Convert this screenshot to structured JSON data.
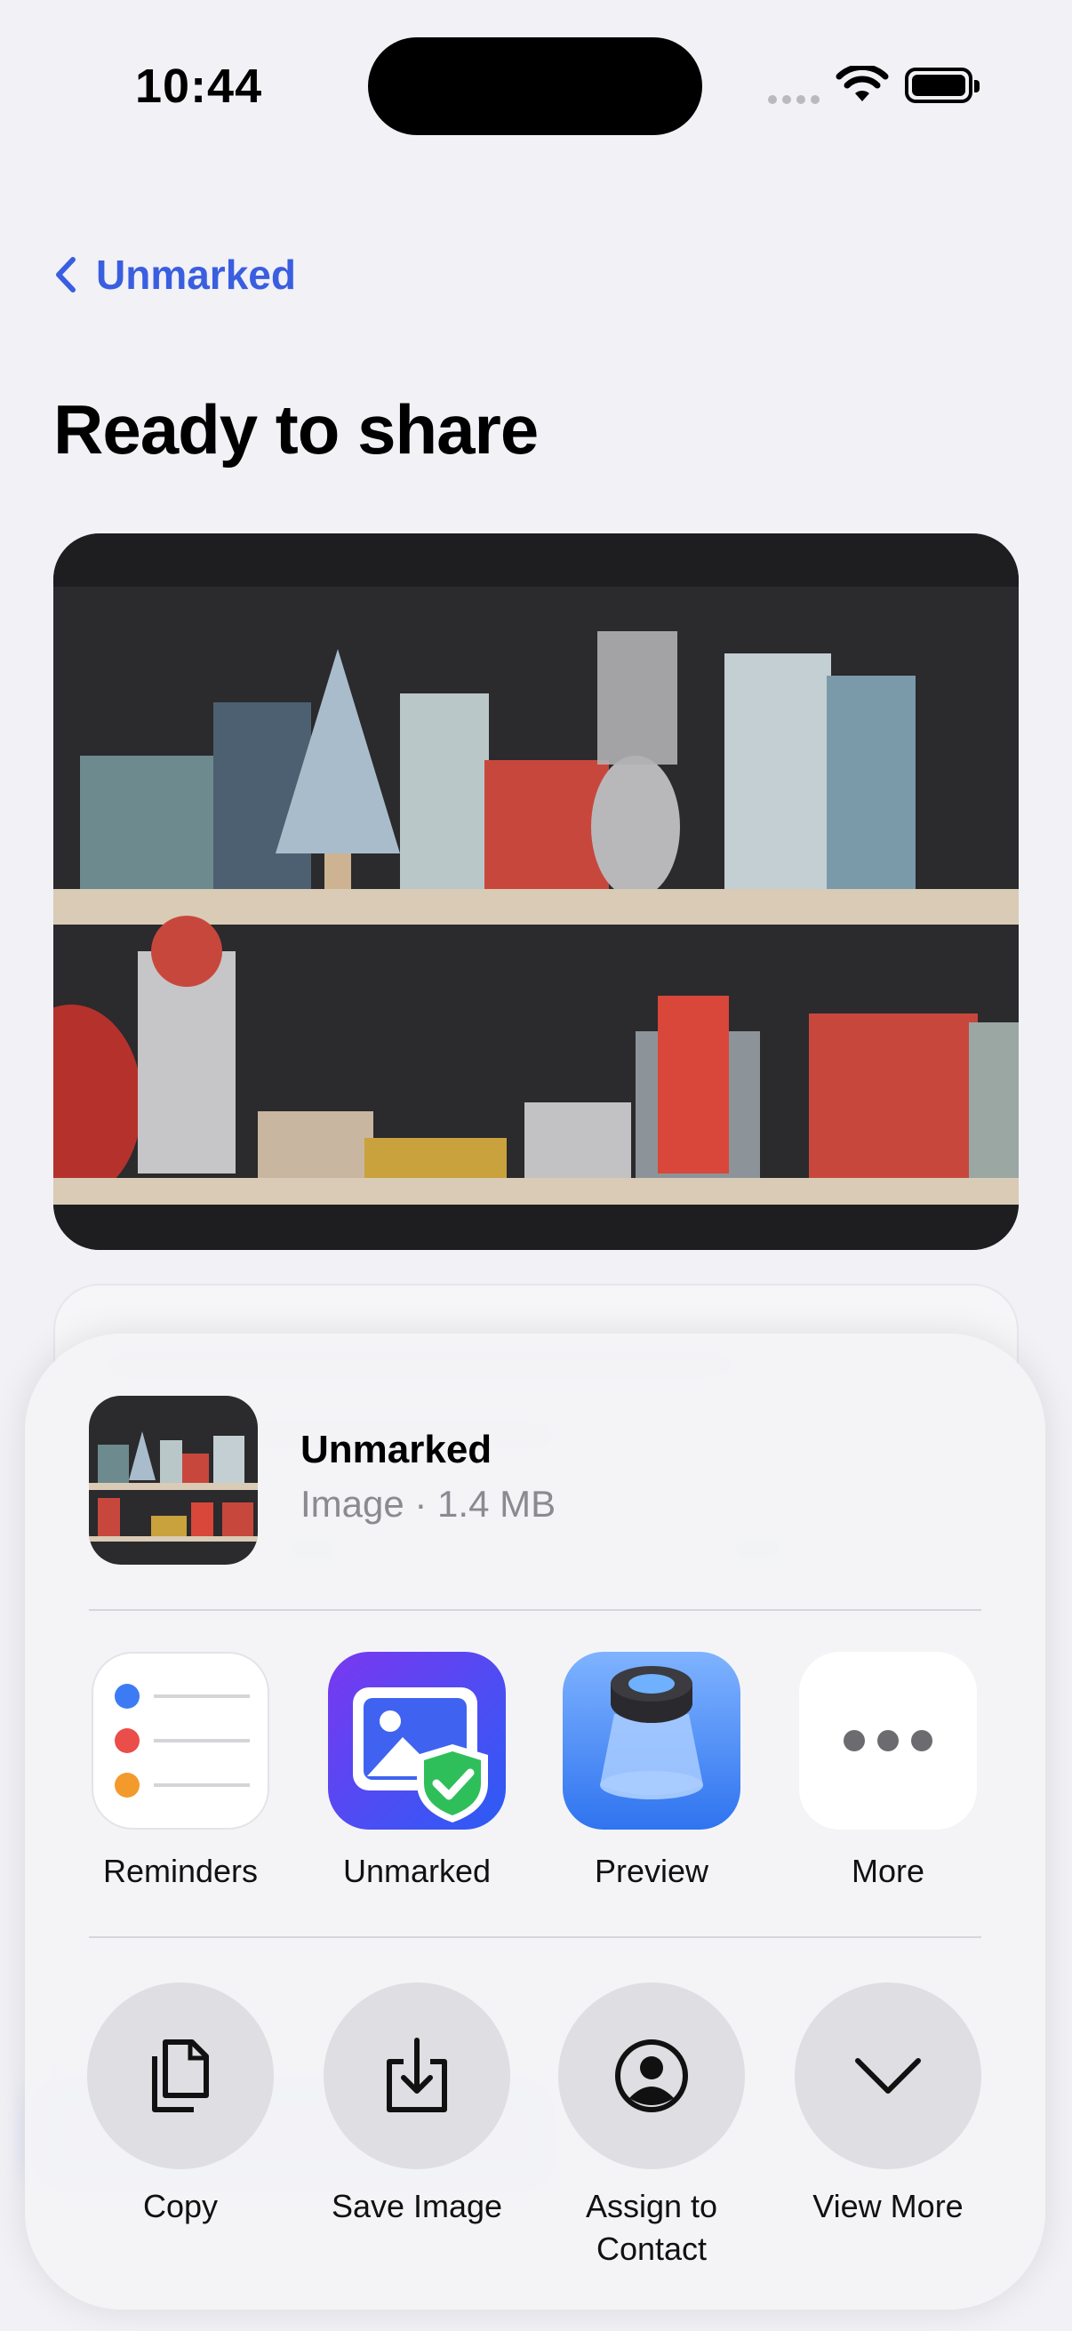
{
  "status_bar": {
    "time": "10:44"
  },
  "nav": {
    "back_label": "Unmarked"
  },
  "page": {
    "title": "Ready to share"
  },
  "share_sheet": {
    "item": {
      "name": "Unmarked",
      "meta": "Image · 1.4 MB"
    },
    "apps": [
      {
        "label": "Reminders",
        "icon": "reminders-icon"
      },
      {
        "label": "Unmarked",
        "icon": "unmarked-app-icon"
      },
      {
        "label": "Preview",
        "icon": "preview-app-icon"
      },
      {
        "label": "More",
        "icon": "more-icon"
      }
    ],
    "actions": [
      {
        "label": "Copy",
        "icon": "copy-icon"
      },
      {
        "label": "Save Image",
        "icon": "save-image-icon"
      },
      {
        "label": "Assign to Contact",
        "icon": "contact-icon"
      },
      {
        "label": "View More",
        "icon": "chevron-down-icon"
      }
    ]
  },
  "colors": {
    "accent": "#3a5ee0",
    "background": "#f1f1f6",
    "sheet": "#f4f4f7"
  }
}
